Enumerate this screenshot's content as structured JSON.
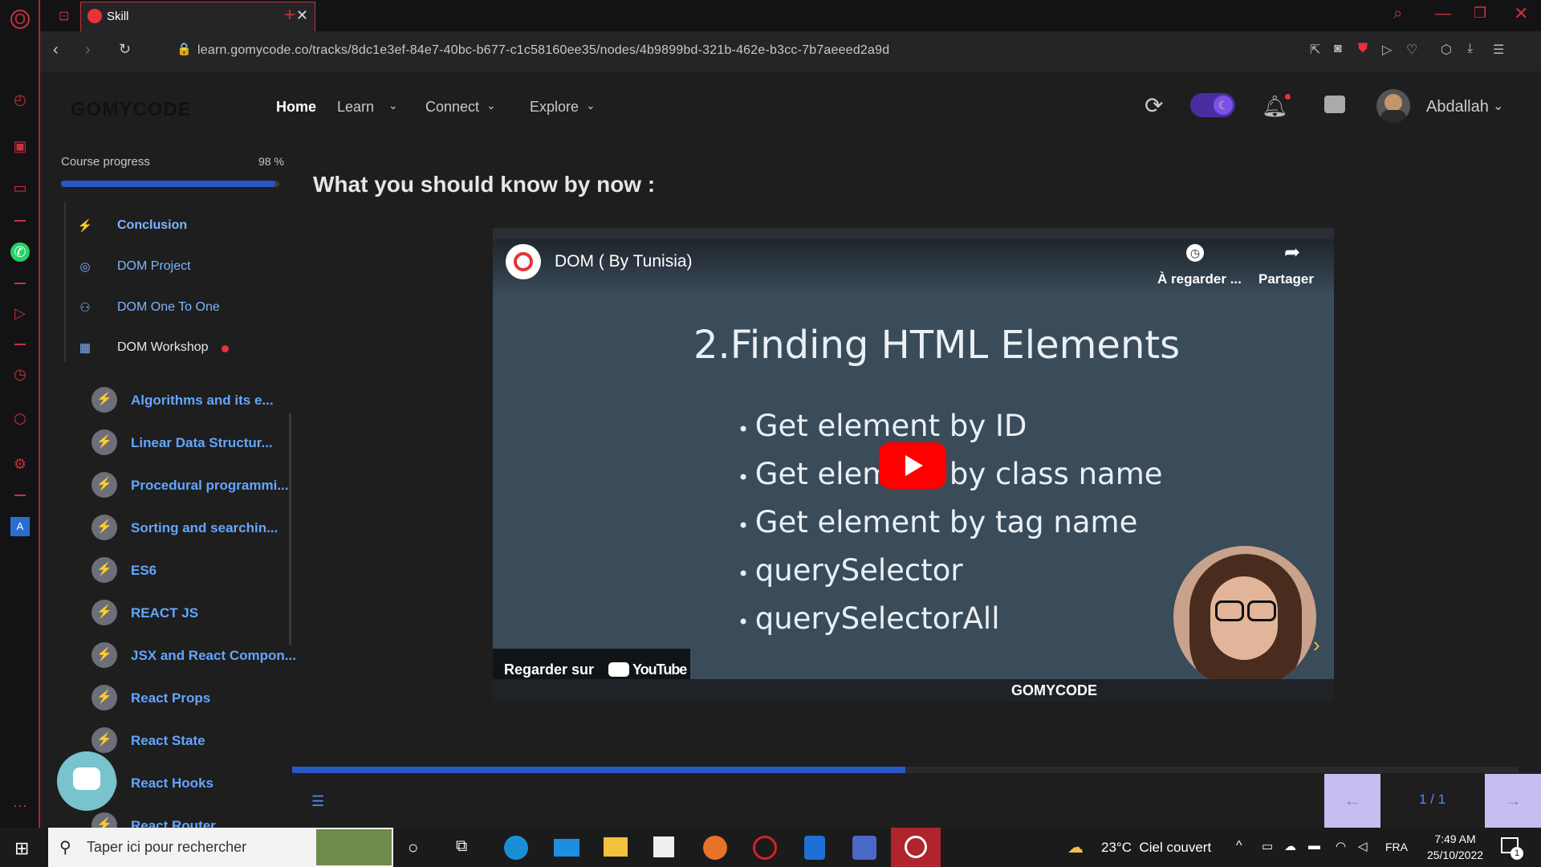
{
  "browser": {
    "tab_title": "Skill",
    "url": "learn.gomycode.co/tracks/8dc1e3ef-84e7-40bc-b677-c1c58160ee35/nodes/4b9899bd-321b-462e-b3cc-7b7aeeed2a9d"
  },
  "header": {
    "logo": "GOMYCODE",
    "nav": {
      "home": "Home",
      "learn": "Learn",
      "connect": "Connect",
      "explore": "Explore"
    },
    "user_name": "Abdallah"
  },
  "sidebar": {
    "progress_label": "Course progress",
    "progress_value": "98 %",
    "progress_fraction": 0.98,
    "lessons": [
      {
        "label": "Conclusion",
        "icon": "bolt-icon"
      },
      {
        "label": "DOM Project",
        "icon": "target-icon"
      },
      {
        "label": "DOM One To One",
        "icon": "people-icon"
      },
      {
        "label": "DOM Workshop",
        "icon": "workshop-icon"
      }
    ],
    "modules": [
      "Algorithms and its e...",
      "Linear Data Structur...",
      "Procedural programmi...",
      "Sorting and searchin...",
      "ES6",
      "REACT JS",
      "JSX and React Compon...",
      "React Props",
      "React State",
      "React Hooks",
      "React Router"
    ]
  },
  "main": {
    "title": "What you should know by now :",
    "video": {
      "channel_title": "DOM ( By Tunisia)",
      "watch_later": "À regarder ...",
      "share": "Partager",
      "slide_title": "2.Finding HTML Elements",
      "bullets": [
        "Get element by ID",
        "Get element by class name",
        "Get element by tag name",
        "querySelector",
        "querySelectorAll"
      ],
      "watch_on": "Regarder sur",
      "youtube": "YouTube",
      "brand": "GOMYCODE"
    },
    "slide_progress_fraction": 0.5,
    "pagination": "1 / 1"
  },
  "taskbar": {
    "search_placeholder": "Taper ici pour rechercher",
    "weather": "23°C  Ciel couvert",
    "language": "FRA",
    "time": "7:49 AM",
    "date": "25/10/2022",
    "notifications": "1"
  }
}
